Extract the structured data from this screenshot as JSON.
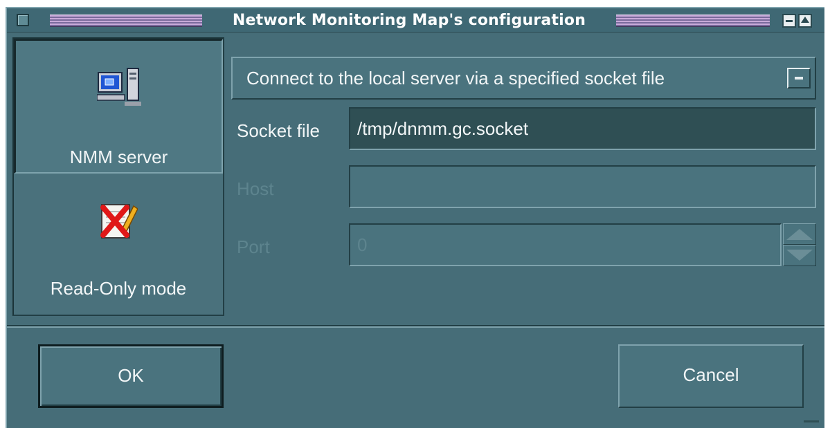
{
  "window": {
    "title": "Network Monitoring Map's configuration"
  },
  "sidebar": {
    "items": [
      {
        "label": "NMM server",
        "icon": "server-computer-icon"
      },
      {
        "label": "Read-Only mode",
        "icon": "read-only-pencil-icon"
      }
    ]
  },
  "connection": {
    "mode_label": "Connect to the local server via a specified socket file",
    "socket_file": {
      "label": "Socket file",
      "value": "/tmp/dnmm.gc.socket"
    },
    "host": {
      "label": "Host",
      "value": ""
    },
    "port": {
      "label": "Port",
      "value": "0"
    }
  },
  "buttons": {
    "ok": "OK",
    "cancel": "Cancel"
  },
  "colors": {
    "window_bg": "#466d78",
    "title_text": "#ffffff",
    "field_active_bg": "#2f4f54",
    "disabled_text": "#5d848e"
  }
}
